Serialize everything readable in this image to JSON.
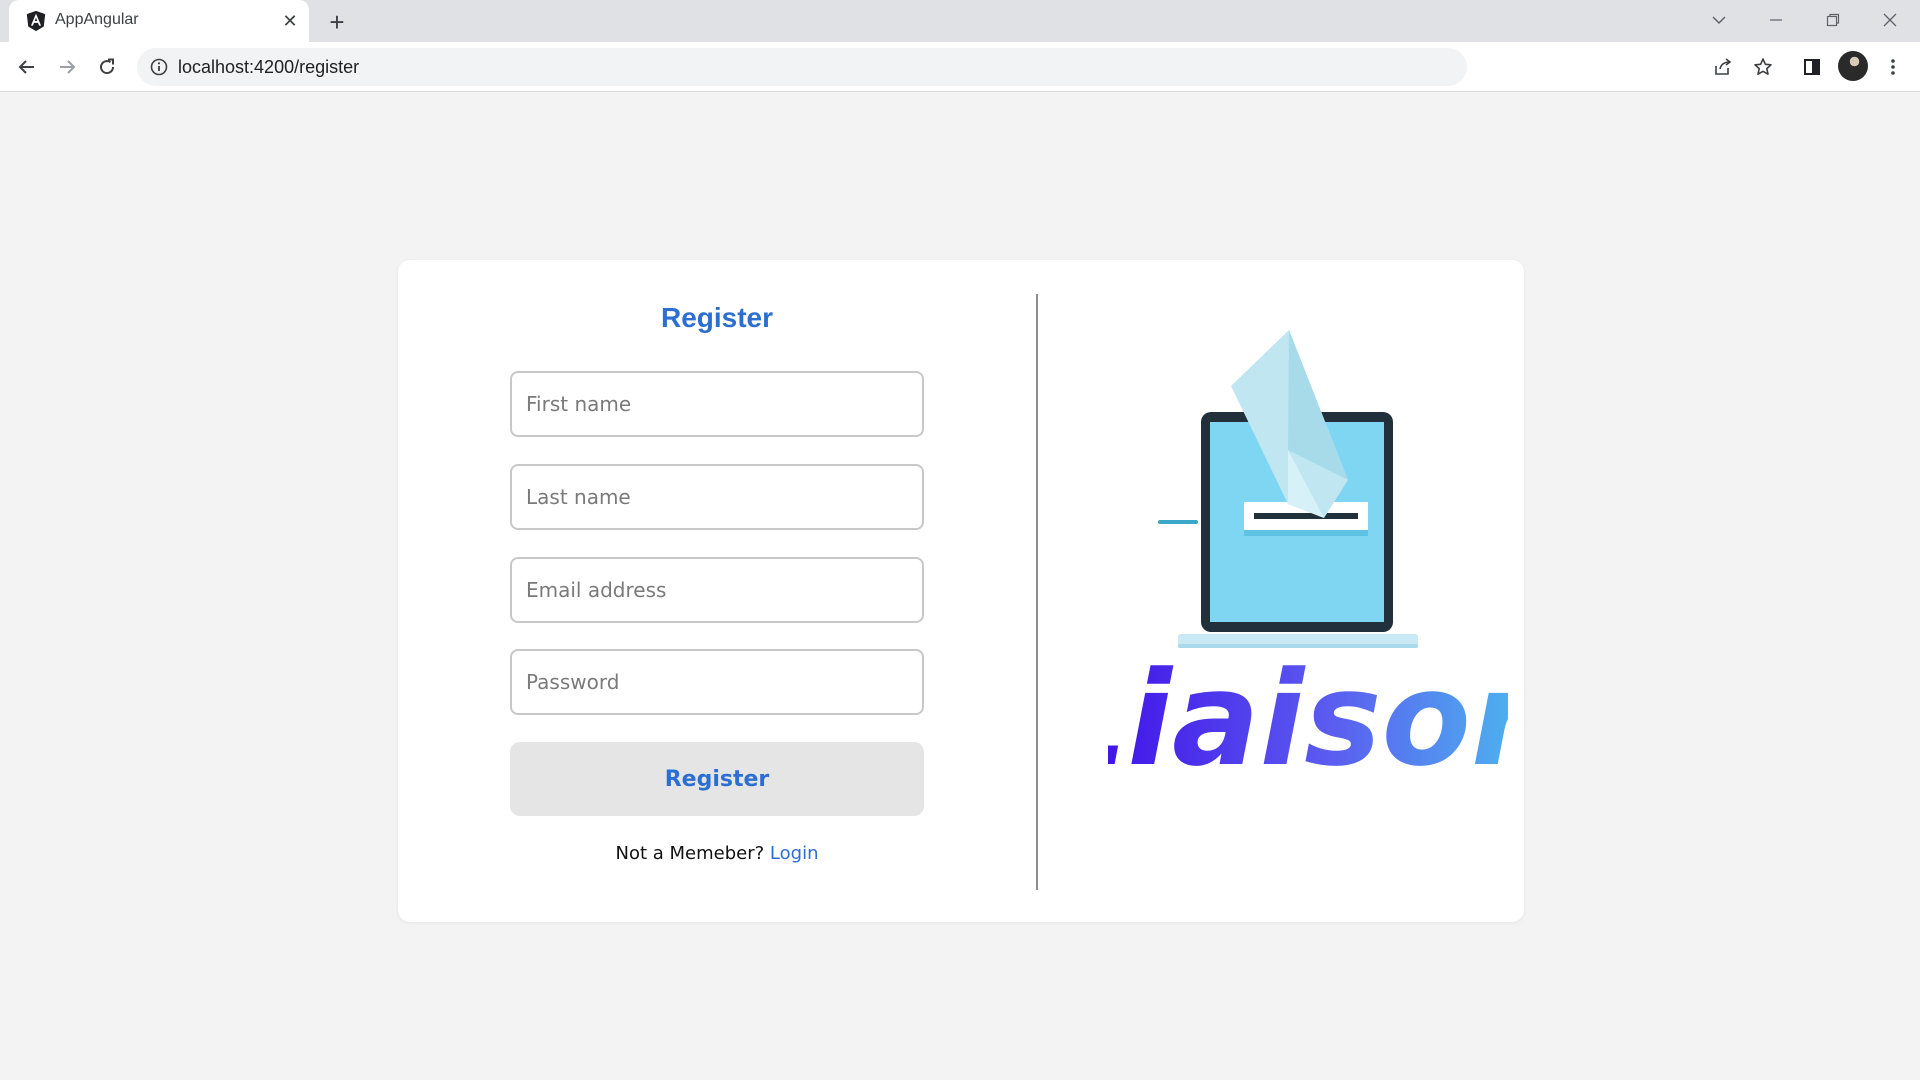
{
  "browser": {
    "tab": {
      "title": "AppAngular",
      "favicon": "angular-logo-icon"
    },
    "address": {
      "url": "localhost:4200/register"
    },
    "icons": {
      "back": "arrow-left-icon",
      "forward": "arrow-right-icon",
      "reload": "reload-icon",
      "share": "share-icon",
      "bookmark": "star-icon",
      "sidepanel": "side-panel-icon",
      "menu": "kebab-menu-icon"
    }
  },
  "form": {
    "title": "Register",
    "first_name_placeholder": "First name",
    "last_name_placeholder": "Last name",
    "email_placeholder": "Email address",
    "password_placeholder": "Password",
    "submit_label": "Register",
    "switch_prompt": "Not a Memeber?",
    "switch_link": "Login"
  },
  "brand": {
    "name": "Liaison",
    "gradient": [
      "#3a00e6",
      "#5b5cf0",
      "#49c8ee"
    ],
    "illustration": "laptop-envelope-illustration"
  },
  "colors": {
    "accent": "#2d6fd1",
    "background": "#f3f3f4",
    "card": "#ffffff"
  }
}
